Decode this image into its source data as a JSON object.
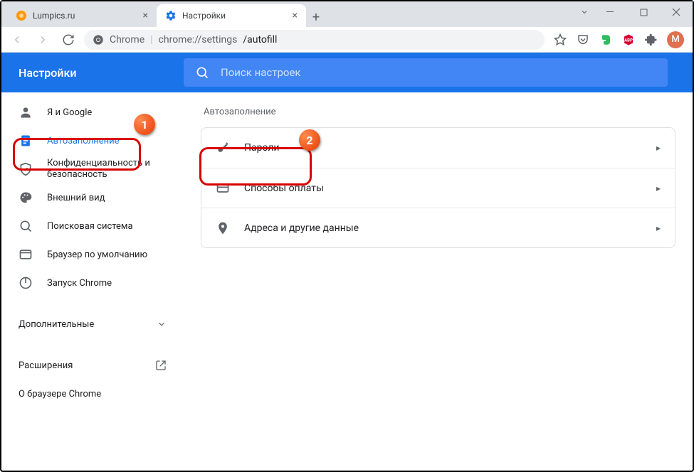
{
  "window": {
    "tabs": [
      {
        "title": "Lumpics.ru",
        "active": false
      },
      {
        "title": "Настройки",
        "active": true
      }
    ]
  },
  "omnibox": {
    "scheme_label": "Chrome",
    "url_host": "chrome://settings",
    "url_path": "/autofill"
  },
  "avatar_initial": "M",
  "settings": {
    "header_title": "Настройки",
    "search_placeholder": "Поиск настроек"
  },
  "sidebar": {
    "items": [
      {
        "label": "Я и Google",
        "icon": "person-icon"
      },
      {
        "label": "Автозаполнение",
        "icon": "autofill-icon",
        "selected": true
      },
      {
        "label": "Конфиденциальность и безопасность",
        "icon": "shield-icon"
      },
      {
        "label": "Внешний вид",
        "icon": "palette-icon"
      },
      {
        "label": "Поисковая система",
        "icon": "search-icon"
      },
      {
        "label": "Браузер по умолчанию",
        "icon": "browser-icon"
      },
      {
        "label": "Запуск Chrome",
        "icon": "power-icon"
      }
    ],
    "advanced_label": "Дополнительные",
    "extensions_label": "Расширения",
    "about_label": "О браузере Chrome"
  },
  "content": {
    "section_title": "Автозаполнение",
    "rows": [
      {
        "label": "Пароли",
        "icon": "key-icon"
      },
      {
        "label": "Способы оплаты",
        "icon": "card-icon"
      },
      {
        "label": "Адреса и другие данные",
        "icon": "location-icon"
      }
    ]
  },
  "callouts": {
    "one": "1",
    "two": "2"
  }
}
